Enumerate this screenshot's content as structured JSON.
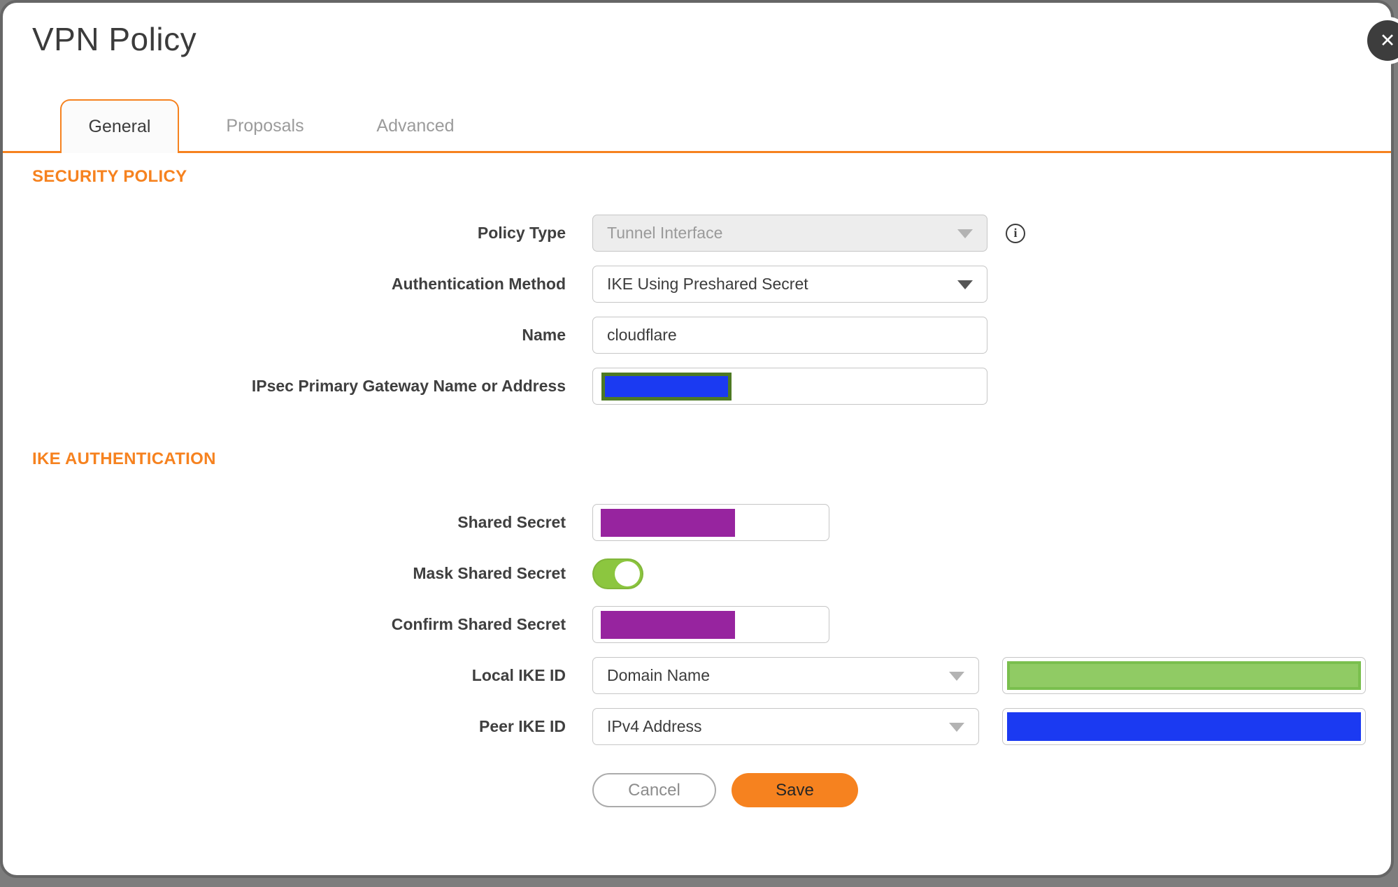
{
  "dialog": {
    "title": "VPN Policy"
  },
  "icons": {
    "close": "✕",
    "info": "i"
  },
  "tabs": [
    {
      "label": "General",
      "active": true
    },
    {
      "label": "Proposals",
      "active": false
    },
    {
      "label": "Advanced",
      "active": false
    }
  ],
  "sections": {
    "security_policy": "SECURITY POLICY",
    "ike_authentication": "IKE AUTHENTICATION"
  },
  "fields": {
    "policy_type": {
      "label": "Policy Type",
      "value": "Tunnel Interface",
      "state": "disabled"
    },
    "authentication_method": {
      "label": "Authentication Method",
      "value": "IKE Using Preshared Secret"
    },
    "name": {
      "label": "Name",
      "value": "cloudflare"
    },
    "ipsec_primary_gateway": {
      "label": "IPsec Primary Gateway Name or Address",
      "value_masked": true
    },
    "shared_secret": {
      "label": "Shared Secret",
      "value_masked": true
    },
    "mask_shared_secret": {
      "label": "Mask Shared Secret",
      "state": "on"
    },
    "confirm_shared_secret": {
      "label": "Confirm Shared Secret",
      "value_masked": true
    },
    "local_ike_id": {
      "label": "Local IKE ID",
      "value": "Domain Name",
      "id_value_masked": true
    },
    "peer_ike_id": {
      "label": "Peer IKE ID",
      "value": "IPv4 Address",
      "id_value_masked": true
    }
  },
  "buttons": {
    "cancel": "Cancel",
    "save": "Save"
  },
  "colors": {
    "accent_orange": "#f6821f",
    "redaction_blue": "#1b3af2",
    "redaction_purple": "#97249f",
    "redaction_green": "#90cb64",
    "redaction_green_border": "#7abf4e",
    "gateway_redaction_border": "#4e7a23",
    "toggle_green": "#8cc63f"
  }
}
